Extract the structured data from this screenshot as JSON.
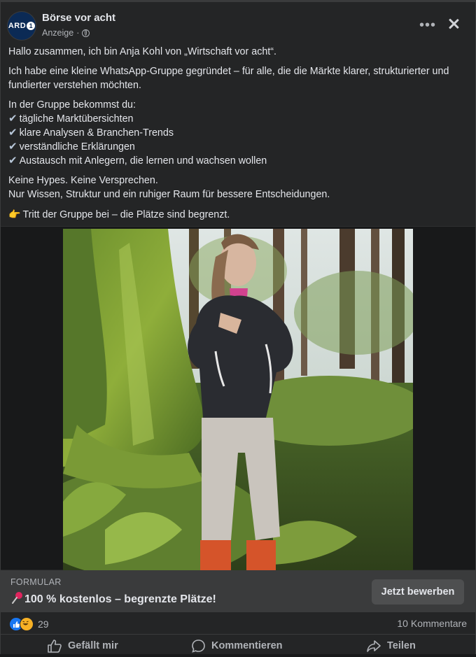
{
  "header": {
    "page_name": "Börse vor acht",
    "sponsored_label": "Anzeige",
    "separator": "·",
    "avatar_text": "ARD",
    "avatar_one": "1"
  },
  "post": {
    "intro": "Hallo zusammen, ich bin Anja Kohl von „Wirtschaft vor acht“.",
    "paragraph2": "Ich habe eine kleine WhatsApp-Gruppe gegründet – für alle, die die Märkte klarer, strukturierter und fundierter verstehen möchten.",
    "list_heading": "In der Gruppe bekommst du:",
    "list_items": [
      "tägliche Marktübersichten",
      "klare Analysen & Branchen-Trends",
      "verständliche Erklärungen",
      "Austausch mit Anlegern, die lernen und wachsen wollen"
    ],
    "closing_line1": "Keine Hypes. Keine Versprechen.",
    "closing_line2": "Nur Wissen, Struktur und ein ruhiger Raum für bessere Entscheidungen.",
    "call_to_action": "Tritt der Gruppe bei – die Plätze sind begrenzt."
  },
  "cta": {
    "label": "FORMULAR",
    "title": "100 % kostenlos – begrenzte Plätze!",
    "button": "Jetzt bewerben"
  },
  "stats": {
    "reaction_count": "29",
    "comments": "10 Kommentare"
  },
  "actions": {
    "like": "Gefällt mir",
    "comment": "Kommentieren",
    "share": "Teilen"
  },
  "colors": {
    "background": "#242526",
    "accent": "#1877f2",
    "text": "#e4e6eb",
    "secondary_text": "#b0b3b8"
  }
}
